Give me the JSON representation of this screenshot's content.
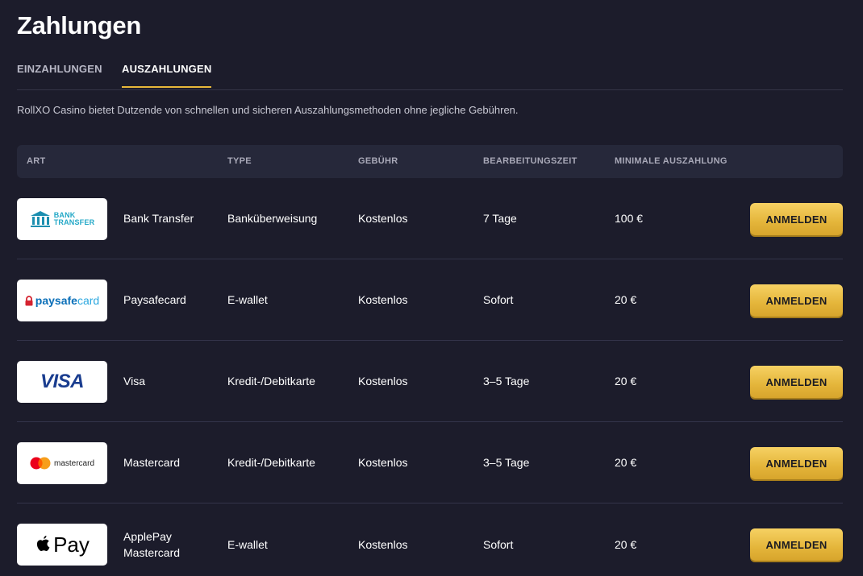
{
  "page": {
    "title": "Zahlungen",
    "tabs": [
      {
        "label": "EINZAHLUNGEN",
        "active": false
      },
      {
        "label": "AUSZAHLUNGEN",
        "active": true
      }
    ],
    "intro": "RollXO Casino bietet Dutzende von schnellen und sicheren Auszahlungsmethoden ohne jegliche Gebühren."
  },
  "table": {
    "headers": [
      "ART",
      "TYPE",
      "GEBÜHR",
      "BEARBEITUNGSZEIT",
      "MINIMALE AUSZAHLUNG"
    ],
    "rows": [
      {
        "logo": "bank-transfer-logo",
        "logo_text": "BANK TRANSFER",
        "name": "Bank Transfer",
        "type": "Banküberweisung",
        "fee": "Kostenlos",
        "time": "7 Tage",
        "min": "100 €",
        "button": "ANMELDEN"
      },
      {
        "logo": "paysafecard-logo",
        "logo_text": "paysafecard",
        "name": "Paysafecard",
        "type": "E-wallet",
        "fee": "Kostenlos",
        "time": "Sofort",
        "min": "20 €",
        "button": "ANMELDEN"
      },
      {
        "logo": "visa-logo",
        "logo_text": "VISA",
        "name": "Visa",
        "type": "Kredit-/Debitkarte",
        "fee": "Kostenlos",
        "time": "3–5 Tage",
        "min": "20 €",
        "button": "ANMELDEN"
      },
      {
        "logo": "mastercard-logo",
        "logo_text": "mastercard",
        "name": "Mastercard",
        "type": "Kredit-/Debitkarte",
        "fee": "Kostenlos",
        "time": "3–5 Tage",
        "min": "20 €",
        "button": "ANMELDEN"
      },
      {
        "logo": "applepay-logo",
        "logo_text": "Pay",
        "name": "ApplePay Mastercard",
        "type": "E-wallet",
        "fee": "Kostenlos",
        "time": "Sofort",
        "min": "20 €",
        "button": "ANMELDEN"
      }
    ]
  },
  "colors": {
    "background": "#1c1c2b",
    "header_bg": "#26283a",
    "accent": "#e8b83a",
    "button_text": "#1a1a22"
  }
}
